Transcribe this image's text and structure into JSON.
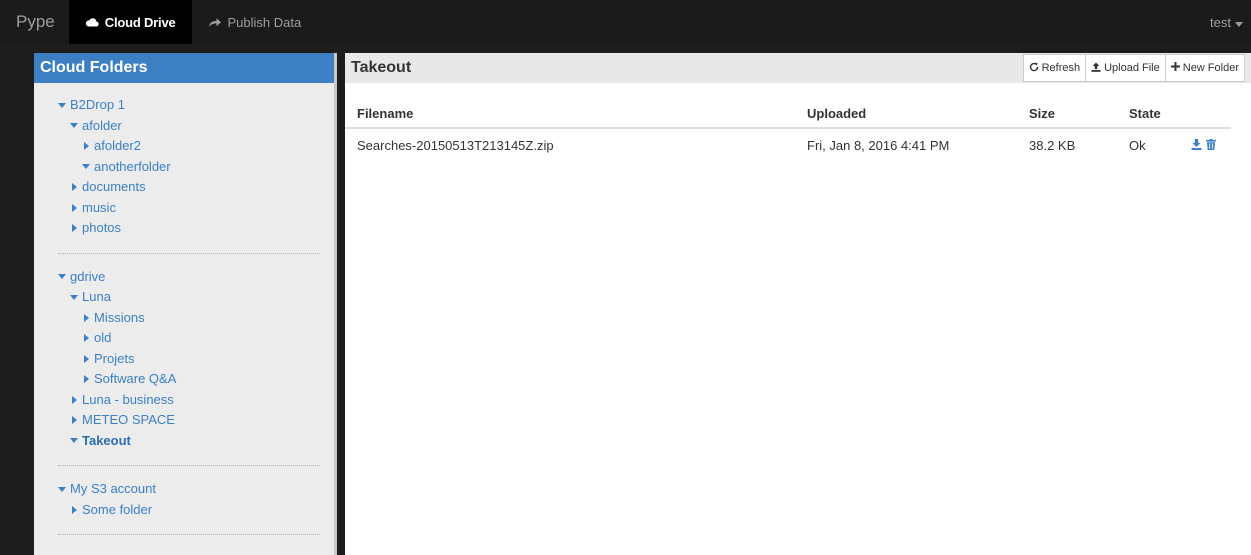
{
  "navbar": {
    "brand": "Pype",
    "items": [
      {
        "label": "Cloud Drive",
        "icon": "cloud-icon",
        "active": true
      },
      {
        "label": "Publish Data",
        "icon": "share-arrow-icon",
        "active": false
      }
    ],
    "user": "test"
  },
  "sidebar": {
    "title": "Cloud Folders",
    "groups": [
      {
        "name": "B2Drop 1",
        "nodes": [
          {
            "label": "B2Drop 1",
            "level": 0,
            "expanded": true
          },
          {
            "label": "afolder",
            "level": 1,
            "expanded": true
          },
          {
            "label": "afolder2",
            "level": 2,
            "expanded": false
          },
          {
            "label": "anotherfolder",
            "level": 2,
            "expanded": true
          },
          {
            "label": "documents",
            "level": 1,
            "expanded": false
          },
          {
            "label": "music",
            "level": 1,
            "expanded": false
          },
          {
            "label": "photos",
            "level": 1,
            "expanded": false
          }
        ]
      },
      {
        "name": "gdrive",
        "nodes": [
          {
            "label": "gdrive",
            "level": 0,
            "expanded": true
          },
          {
            "label": "Luna",
            "level": 1,
            "expanded": true
          },
          {
            "label": "Missions",
            "level": 2,
            "expanded": false
          },
          {
            "label": "old",
            "level": 2,
            "expanded": false
          },
          {
            "label": "Projets",
            "level": 2,
            "expanded": false
          },
          {
            "label": "Software Q&A",
            "level": 2,
            "expanded": false
          },
          {
            "label": "Luna - business",
            "level": 1,
            "expanded": false
          },
          {
            "label": "METEO SPACE",
            "level": 1,
            "expanded": false
          },
          {
            "label": "Takeout",
            "level": 1,
            "expanded": true,
            "selected": true
          }
        ]
      },
      {
        "name": "My S3 account",
        "nodes": [
          {
            "label": "My S3 account",
            "level": 0,
            "expanded": true
          },
          {
            "label": "Some folder",
            "level": 1,
            "expanded": false
          }
        ]
      }
    ]
  },
  "main": {
    "folder_title": "Takeout",
    "buttons": {
      "refresh": "Refresh",
      "upload": "Upload File",
      "new_folder": "New Folder"
    },
    "columns": {
      "filename": "Filename",
      "uploaded": "Uploaded",
      "size": "Size",
      "state": "State"
    },
    "files": [
      {
        "filename": "Searches-20150513T213145Z.zip",
        "uploaded": "Fri, Jan 8, 2016 4:41 PM",
        "size": "38.2 KB",
        "state": "Ok"
      }
    ]
  },
  "colors": {
    "accent": "#3c80c3",
    "navbar_bg": "#1b1b1b",
    "sidebar_bg": "#ececec"
  }
}
